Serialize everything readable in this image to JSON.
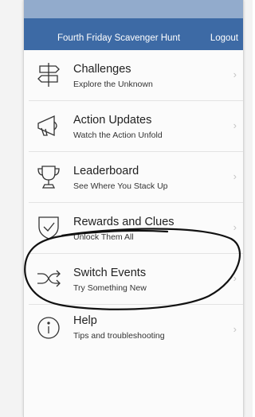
{
  "header": {
    "title": "Fourth Friday Scavenger Hunt",
    "logout_label": "Logout",
    "background_color": "#3d6aa5"
  },
  "menu": {
    "items": [
      {
        "title": "Challenges",
        "subtitle": "Explore the Unknown",
        "icon": "signpost-icon"
      },
      {
        "title": "Action Updates",
        "subtitle": "Watch the Action Unfold",
        "icon": "megaphone-icon"
      },
      {
        "title": "Leaderboard",
        "subtitle": "See Where You Stack Up",
        "icon": "trophy-icon"
      },
      {
        "title": "Rewards and Clues",
        "subtitle": "Unlock Them All",
        "icon": "shield-check-icon"
      },
      {
        "title": "Switch Events",
        "subtitle": "Try Something New",
        "icon": "shuffle-icon"
      },
      {
        "title": "Help",
        "subtitle": "Tips and troubleshooting",
        "icon": "info-icon"
      }
    ],
    "chevron": "›"
  }
}
